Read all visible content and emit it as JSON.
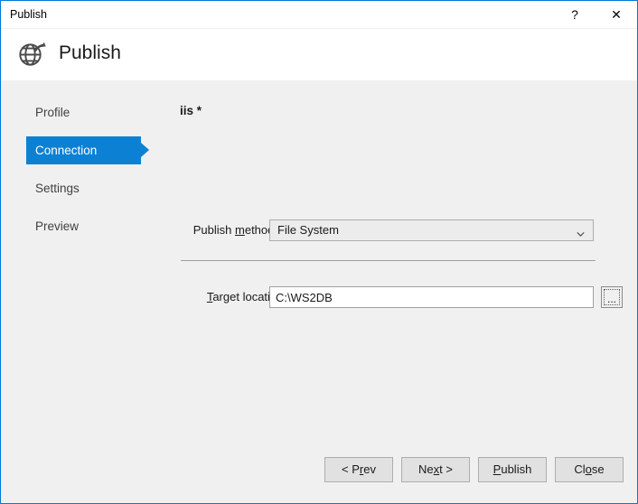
{
  "window": {
    "title": "Publish",
    "accent_color": "#0078d7",
    "body_background": "#f0f0f0",
    "caption_buttons": {
      "help": "?",
      "close": "✕"
    }
  },
  "header": {
    "icon": "globe-publish-icon",
    "title": "Publish"
  },
  "sidebar": {
    "items": [
      {
        "label": "Profile",
        "selected": false
      },
      {
        "label": "Connection",
        "selected": true
      },
      {
        "label": "Settings",
        "selected": false
      },
      {
        "label": "Preview",
        "selected": false
      }
    ],
    "selected_color": "#0c81d4"
  },
  "main": {
    "profile_title": "iis *",
    "publish_method": {
      "label_before": "Publish ",
      "label_accel": "m",
      "label_after": "ethod:",
      "value": "File System",
      "chevron": "chevron-down-icon"
    },
    "target_location": {
      "label_accel": "T",
      "label_after": "arget location:",
      "value": "C:\\WS2DB",
      "placeholder": "",
      "browse_label": "..."
    }
  },
  "footer": {
    "buttons": [
      {
        "before": "< P",
        "accel": "r",
        "after": "ev"
      },
      {
        "before": "Ne",
        "accel": "x",
        "after": "t >"
      },
      {
        "before": "",
        "accel": "P",
        "after": "ublish"
      },
      {
        "before": "Cl",
        "accel": "o",
        "after": "se"
      }
    ]
  }
}
